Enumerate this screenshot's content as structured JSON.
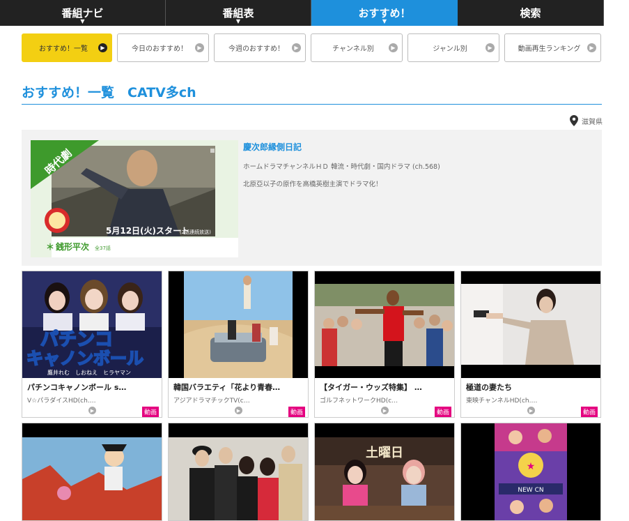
{
  "nav": {
    "tabs": [
      {
        "label": "番組ナビ"
      },
      {
        "label": "番組表"
      },
      {
        "label": "おすすめ！"
      },
      {
        "label": "検索"
      }
    ]
  },
  "subtabs": [
    {
      "label": "おすすめ！一覧"
    },
    {
      "label": "今日のおすすめ！"
    },
    {
      "label": "今週のおすすめ！"
    },
    {
      "label": "チャンネル別"
    },
    {
      "label": "ジャンル別"
    },
    {
      "label": "動画再生ランキング"
    }
  ],
  "heading": "おすすめ！一覧　CATV多ch",
  "region": "滋賀県",
  "featured": {
    "title": "慶次郎縁側日記",
    "meta": "ホームドラマチャンネルＨＤ 韓流・時代劇・国内ドラマ (ch.568)",
    "description": "北原亞以子の原作を高橋英樹主演でドラマ化！",
    "thumb": {
      "ribbon": "時代劇",
      "start": "5月12日(火)スタート",
      "start_note": "(2話連続放送)",
      "show": "銭形平次",
      "episodes": "全37話"
    }
  },
  "cards": [
    {
      "title": "パチンコキャノンボール s…",
      "channel": "V☆パラダイスHD(ch.…",
      "badge": "動画",
      "logo1": "パチンコ",
      "logo2": "キャノンボール",
      "names": "鷹井れむ　しおねえ　ヒラヤマン"
    },
    {
      "title": "韓国バラエティ「花より青春…",
      "channel": "アジアドラマチックTV(c…",
      "badge": "動画"
    },
    {
      "title": "【タイガー・ウッズ特集】 …",
      "channel": "ゴルフネットワークHD(c…",
      "badge": "動画"
    },
    {
      "title": "極道の妻たち",
      "channel": "東映チャンネルHD(ch.…",
      "badge": "動画"
    }
  ],
  "row2": [
    {
      "caption": ""
    },
    {
      "caption": ""
    },
    {
      "caption": "土曜日"
    },
    {
      "caption": "NEW CN"
    }
  ]
}
